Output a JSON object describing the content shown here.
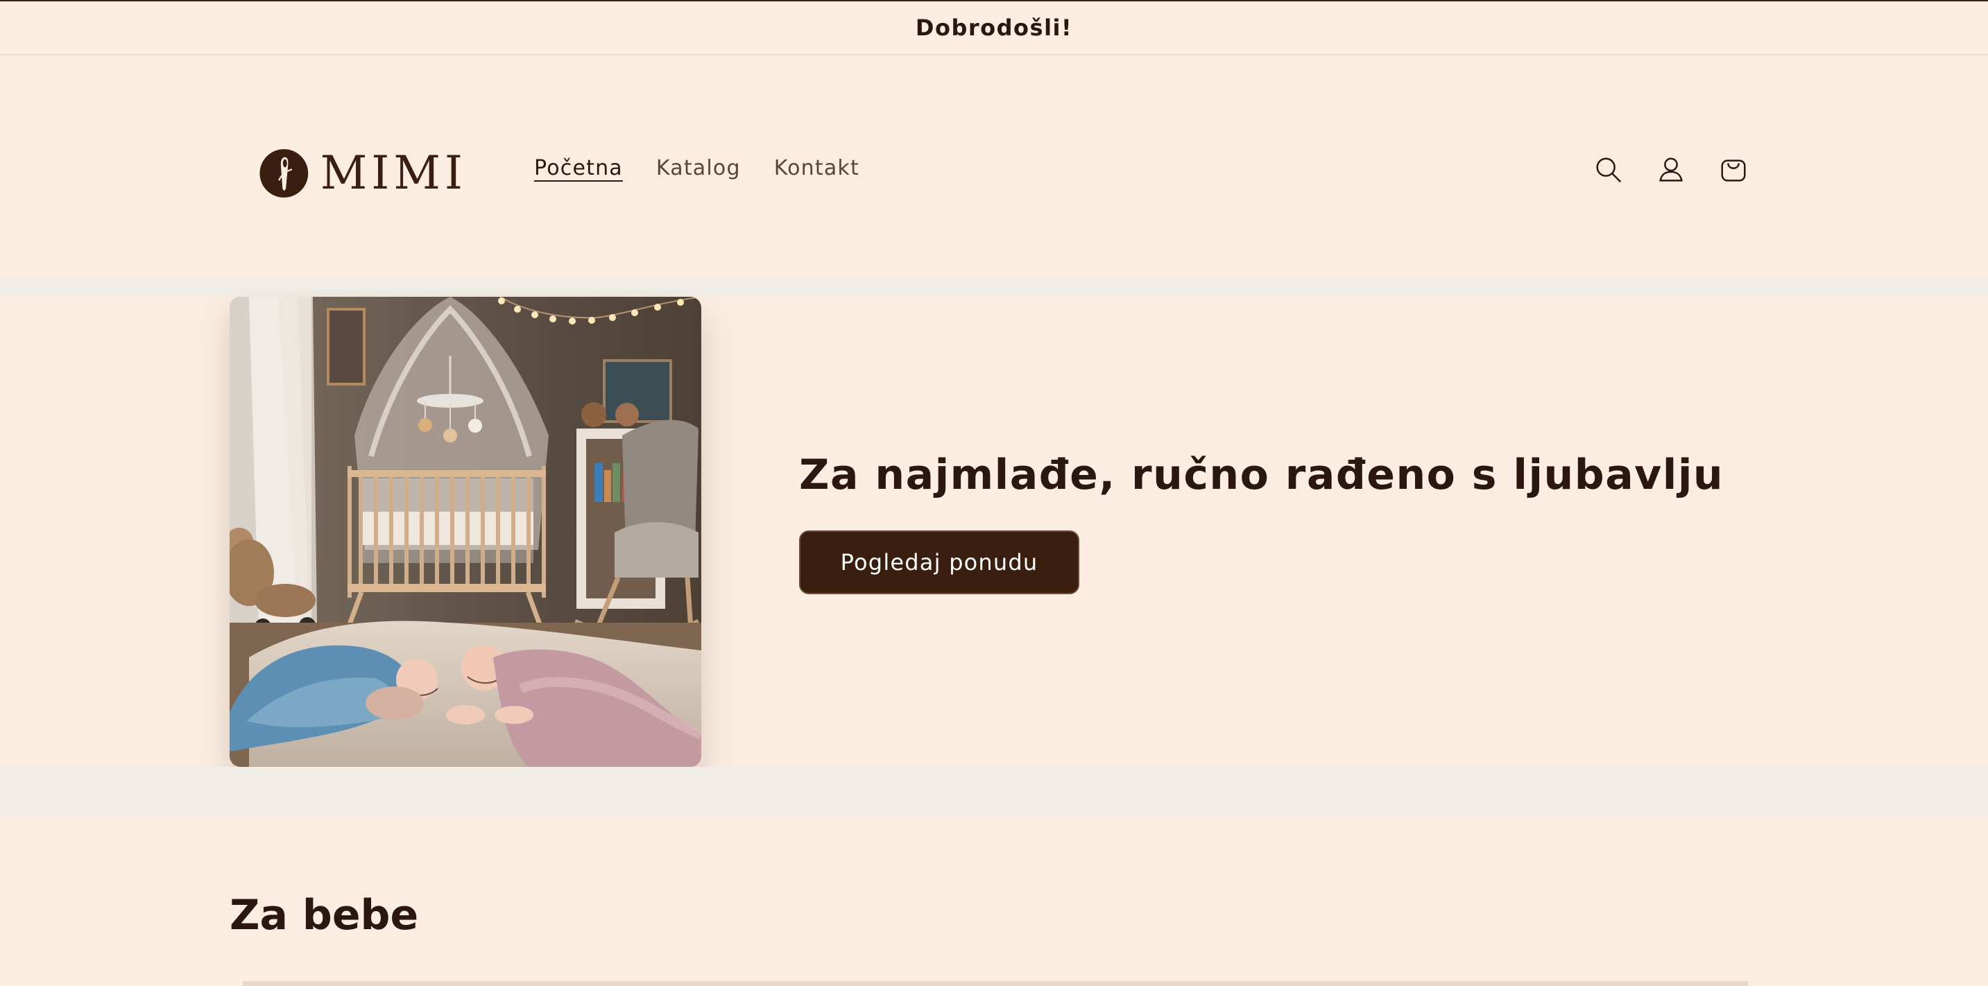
{
  "announcement": {
    "text": "Dobrodošli!"
  },
  "brand": {
    "name": "MIMI"
  },
  "nav": {
    "items": [
      {
        "label": "Početna",
        "active": true
      },
      {
        "label": "Katalog",
        "active": false
      },
      {
        "label": "Kontakt",
        "active": false
      }
    ]
  },
  "icons": {
    "search": "search-icon",
    "account": "user-icon",
    "cart": "cart-icon"
  },
  "hero": {
    "title": "Za najmlađe, ručno rađeno s ljubavlju",
    "button_label": "Pogledaj ponudu"
  },
  "section": {
    "title": "Za bebe"
  },
  "colors": {
    "background": "#FBEEE1",
    "accent": "#3A1E10",
    "band": "#F2EDE6"
  }
}
